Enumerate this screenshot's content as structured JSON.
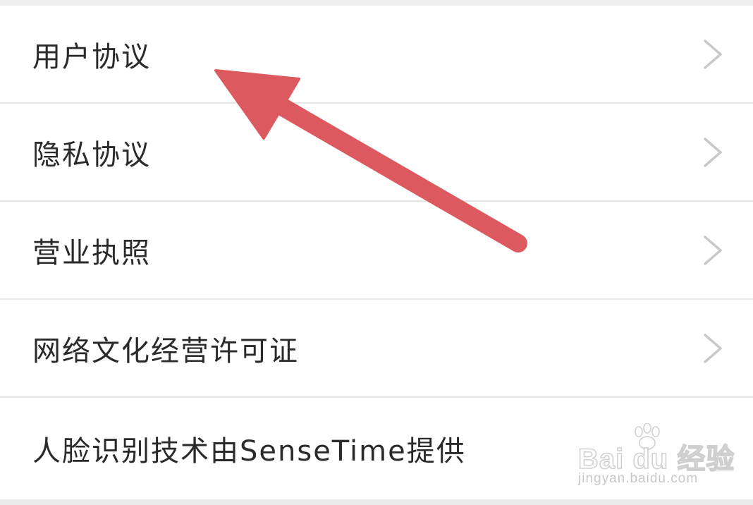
{
  "menu": {
    "items": [
      {
        "label": "用户协议"
      },
      {
        "label": "隐私协议"
      },
      {
        "label": "营业执照"
      },
      {
        "label": "网络文化经营许可证"
      },
      {
        "label": "人脸识别技术由SenseTime提供"
      }
    ],
    "chevron_icon": "chevron-right-icon"
  },
  "annotation": {
    "type": "arrow",
    "color": "#dc5960",
    "points_to": "用户协议"
  },
  "watermark": {
    "brand": "Bai du 经验",
    "url": "jingyan.baidu.com",
    "icon": "paw-icon"
  },
  "colors": {
    "background": "#ffffff",
    "divider": "#e6e6e6",
    "text": "#2a2a2a",
    "chevron": "#c9c9c9",
    "arrow": "#dc5960"
  }
}
